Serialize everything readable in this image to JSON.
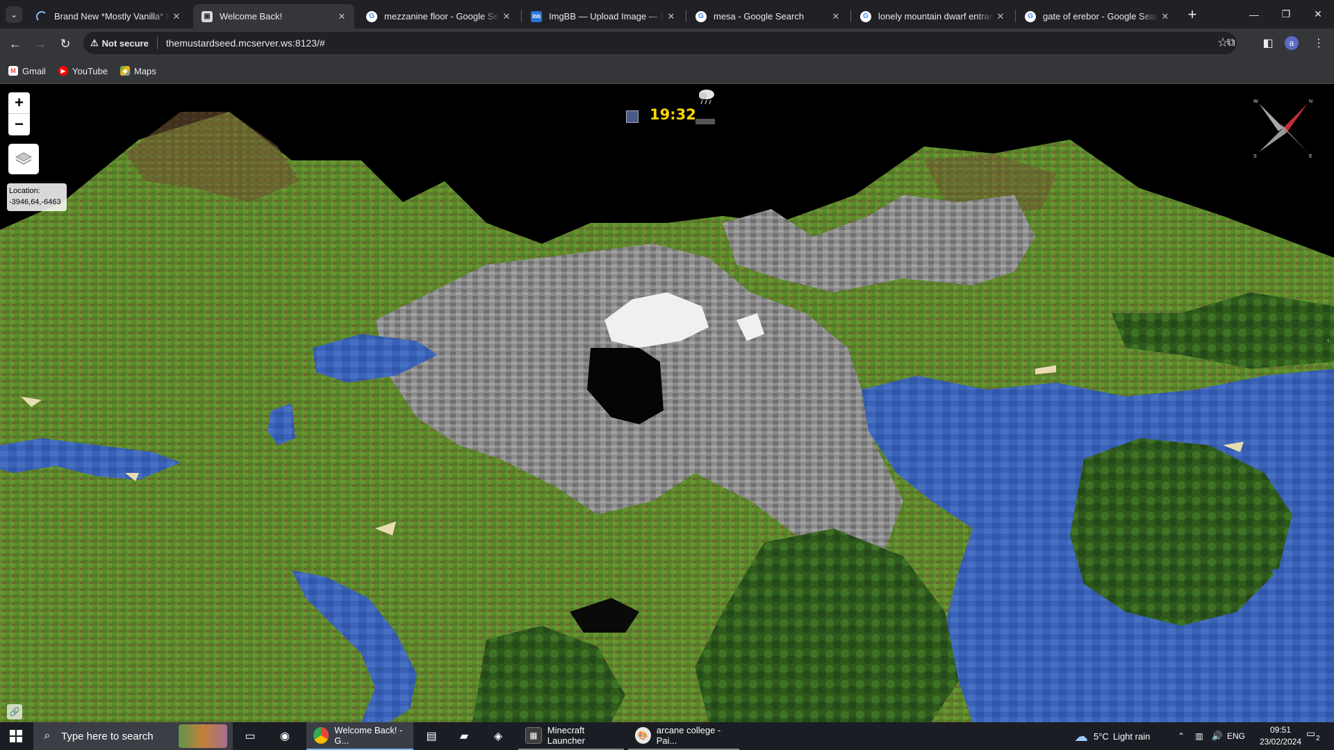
{
  "browser": {
    "tabs": [
      {
        "title": "Brand New *Mostly Vanilla* Mi",
        "favicon": "loading-spinner-icon",
        "active": false
      },
      {
        "title": "Welcome Back!",
        "favicon": "dynmap-icon",
        "active": true
      },
      {
        "title": "mezzanine floor - Google Searc",
        "favicon": "google-icon",
        "active": false
      },
      {
        "title": "ImgBB — Upload Image — Fre",
        "favicon": "imgbb-icon",
        "active": false
      },
      {
        "title": "mesa - Google Search",
        "favicon": "google-icon",
        "active": false
      },
      {
        "title": "lonely mountain dwarf entranc",
        "favicon": "google-icon",
        "active": false
      },
      {
        "title": "gate of erebor - Google Search",
        "favicon": "google-icon",
        "active": false
      }
    ],
    "security_label": "Not secure",
    "url": "themustardseed.mcserver.ws:8123/#",
    "profile_initial": "a",
    "bookmarks": [
      {
        "label": "Gmail",
        "icon": "gmail-icon"
      },
      {
        "label": "YouTube",
        "icon": "youtube-icon"
      },
      {
        "label": "Maps",
        "icon": "maps-icon"
      }
    ]
  },
  "map": {
    "zoom_in": "+",
    "zoom_out": "−",
    "location_label": "Location:",
    "location_value": "-3946,64,-6463",
    "time": "19:32",
    "weather": "rain-cloud-icon",
    "compass_labels": {
      "n": "N",
      "e": "E",
      "s": "S",
      "w": "W"
    }
  },
  "taskbar": {
    "search_placeholder": "Type here to search",
    "apps": [
      {
        "label": "Welcome Back! - G...",
        "icon": "chrome-icon",
        "state": "active"
      },
      {
        "label": "Minecraft Launcher",
        "icon": "minecraft-icon",
        "state": "running"
      },
      {
        "label": "arcane college - Pai...",
        "icon": "paint-icon",
        "state": "running"
      }
    ],
    "weather_temp": "5°C",
    "weather_desc": "Light rain",
    "language": "ENG",
    "time": "09:51",
    "date": "23/02/2024",
    "notification_count": "2"
  },
  "colors": {
    "chrome_dark": "#202124",
    "chrome_toolbar": "#35363a",
    "clock_yellow": "#ffd700",
    "taskbar": "#1b1d24",
    "water": "#3a62b8",
    "grass": "#5f8a2e",
    "stone": "#8e8e8e"
  }
}
